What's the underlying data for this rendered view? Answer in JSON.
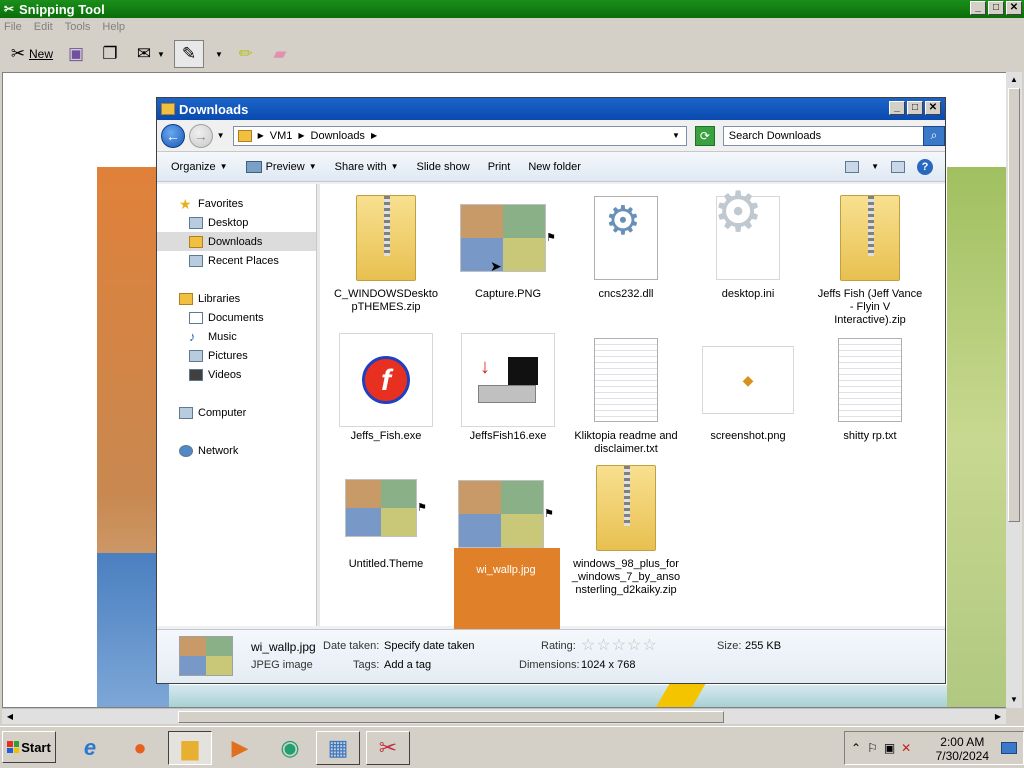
{
  "snipping_tool": {
    "title": "Snipping Tool",
    "menu": [
      "File",
      "Edit",
      "Tools",
      "Help"
    ],
    "toolbar": {
      "new_label": "New"
    }
  },
  "explorer": {
    "title": "Downloads",
    "breadcrumb": [
      "VM1",
      "Downloads"
    ],
    "search_placeholder": "Search Downloads",
    "commands": {
      "organize": "Organize",
      "preview": "Preview",
      "share": "Share with",
      "slideshow": "Slide show",
      "print": "Print",
      "new_folder": "New folder"
    },
    "nav": {
      "favorites": "Favorites",
      "desktop": "Desktop",
      "downloads": "Downloads",
      "recent": "Recent Places",
      "libraries": "Libraries",
      "documents": "Documents",
      "music": "Music",
      "pictures": "Pictures",
      "videos": "Videos",
      "computer": "Computer",
      "network": "Network"
    },
    "files": [
      {
        "name": "C_WINDOWSDesktopTHEMES.zip",
        "kind": "zip"
      },
      {
        "name": "Capture.PNG",
        "kind": "image"
      },
      {
        "name": "cncs232.dll",
        "kind": "dll"
      },
      {
        "name": "desktop.ini",
        "kind": "ini"
      },
      {
        "name": "Jeffs Fish (Jeff Vance - Flyin V Interactive).zip",
        "kind": "zip"
      },
      {
        "name": "Jeffs_Fish.exe",
        "kind": "exe-flash"
      },
      {
        "name": "JeffsFish16.exe",
        "kind": "exe-disk"
      },
      {
        "name": "Kliktopia readme and disclaimer.txt",
        "kind": "txt"
      },
      {
        "name": "screenshot.png",
        "kind": "png"
      },
      {
        "name": "shitty rp.txt",
        "kind": "txt"
      },
      {
        "name": "Untitled.Theme",
        "kind": "theme"
      },
      {
        "name": "wi_wallp.jpg",
        "kind": "image",
        "selected": true
      },
      {
        "name": "windows_98_plus_for_windows_7_by_ansonsterling_d2kaiky.zip",
        "kind": "zip"
      }
    ],
    "details": {
      "filename": "wi_wallp.jpg",
      "filetype": "JPEG image",
      "date_label": "Date taken:",
      "date_value": "Specify date taken",
      "tags_label": "Tags:",
      "tags_value": "Add a tag",
      "rating_label": "Rating:",
      "rating_stars": "☆☆☆☆☆",
      "dimensions_label": "Dimensions:",
      "dimensions_value": "1024 x 768",
      "size_label": "Size:",
      "size_value": "255 KB"
    }
  },
  "taskbar": {
    "start_label": "Start",
    "clock_time": "2:00 AM",
    "clock_date": "7/30/2024"
  },
  "colors": {
    "selection": "#e08028",
    "title_green": "#0a6e0a",
    "title_blue": "#0a4ab0"
  }
}
